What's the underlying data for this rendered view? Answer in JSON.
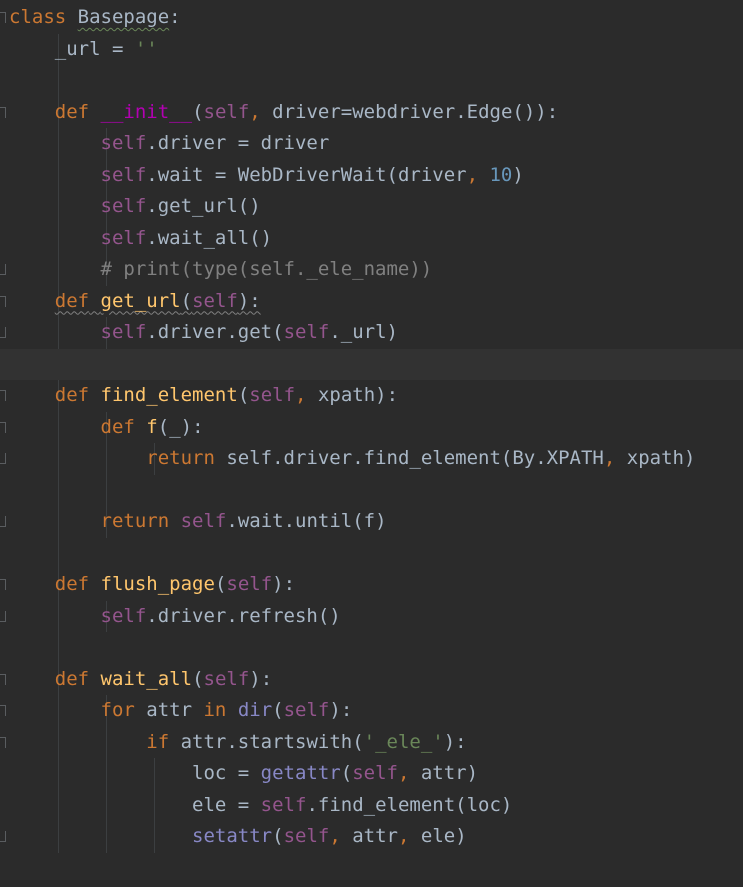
{
  "lines": [
    {
      "tokens": [
        [
          "kw",
          "class"
        ],
        [
          "plain",
          " "
        ],
        [
          "cls-sq",
          "Basepage"
        ],
        [
          "plain",
          ":"
        ]
      ]
    },
    {
      "tokens": [
        [
          "plain",
          "    _url = "
        ],
        [
          "str",
          "''"
        ]
      ]
    },
    {
      "tokens": []
    },
    {
      "tokens": [
        [
          "plain",
          "    "
        ],
        [
          "kw",
          "def"
        ],
        [
          "plain",
          " "
        ],
        [
          "dunder",
          "__init__"
        ],
        [
          "plain",
          "("
        ],
        [
          "self",
          "self"
        ],
        [
          "kw",
          ","
        ],
        [
          "plain",
          " driver=webdriver.Edge()):"
        ]
      ]
    },
    {
      "tokens": [
        [
          "plain",
          "        "
        ],
        [
          "self",
          "self"
        ],
        [
          "plain",
          ".driver = driver"
        ]
      ]
    },
    {
      "tokens": [
        [
          "plain",
          "        "
        ],
        [
          "self",
          "self"
        ],
        [
          "plain",
          ".wait = WebDriverWait(driver"
        ],
        [
          "kw",
          ","
        ],
        [
          "plain",
          " "
        ],
        [
          "num",
          "10"
        ],
        [
          "plain",
          ")"
        ]
      ]
    },
    {
      "tokens": [
        [
          "plain",
          "        "
        ],
        [
          "self",
          "self"
        ],
        [
          "plain",
          ".get_url()"
        ]
      ]
    },
    {
      "tokens": [
        [
          "plain",
          "        "
        ],
        [
          "self",
          "self"
        ],
        [
          "plain",
          ".wait_all()"
        ]
      ]
    },
    {
      "tokens": [
        [
          "cmt",
          "        # print(type(self._ele_name))"
        ]
      ]
    },
    {
      "tokens": [
        [
          "plain",
          "    "
        ],
        [
          "kw-sq",
          "def"
        ],
        [
          "plain-sq",
          " "
        ],
        [
          "fn-sq",
          "get_url"
        ],
        [
          "plain-sq",
          "("
        ],
        [
          "self-sq",
          "self"
        ],
        [
          "plain-sq",
          "):"
        ]
      ]
    },
    {
      "tokens": [
        [
          "plain",
          "        "
        ],
        [
          "self",
          "self"
        ],
        [
          "plain",
          ".driver.get("
        ],
        [
          "self",
          "self"
        ],
        [
          "plain",
          "._url)"
        ]
      ]
    },
    {
      "tokens": []
    },
    {
      "tokens": [
        [
          "plain",
          "    "
        ],
        [
          "kw",
          "def"
        ],
        [
          "plain",
          " "
        ],
        [
          "fn",
          "find_element"
        ],
        [
          "plain",
          "("
        ],
        [
          "self",
          "self"
        ],
        [
          "kw",
          ","
        ],
        [
          "plain",
          " xpath):"
        ]
      ]
    },
    {
      "tokens": [
        [
          "plain",
          "        "
        ],
        [
          "kw",
          "def"
        ],
        [
          "plain",
          " "
        ],
        [
          "fn",
          "f"
        ],
        [
          "plain",
          "(_):"
        ]
      ]
    },
    {
      "tokens": [
        [
          "plain",
          "            "
        ],
        [
          "kw",
          "return"
        ],
        [
          "plain",
          " self.driver.find_element(By.XPATH"
        ],
        [
          "kw",
          ","
        ],
        [
          "plain",
          " xpath)"
        ]
      ]
    },
    {
      "tokens": []
    },
    {
      "tokens": [
        [
          "plain",
          "        "
        ],
        [
          "kw",
          "return"
        ],
        [
          "plain",
          " "
        ],
        [
          "self",
          "self"
        ],
        [
          "plain",
          ".wait.until(f)"
        ]
      ]
    },
    {
      "tokens": []
    },
    {
      "tokens": [
        [
          "plain",
          "    "
        ],
        [
          "kw",
          "def"
        ],
        [
          "plain",
          " "
        ],
        [
          "fn",
          "flush_page"
        ],
        [
          "plain",
          "("
        ],
        [
          "self",
          "self"
        ],
        [
          "plain",
          "):"
        ]
      ]
    },
    {
      "tokens": [
        [
          "plain",
          "        "
        ],
        [
          "self",
          "self"
        ],
        [
          "plain",
          ".driver.refresh()"
        ]
      ]
    },
    {
      "tokens": []
    },
    {
      "tokens": [
        [
          "plain",
          "    "
        ],
        [
          "kw",
          "def"
        ],
        [
          "plain",
          " "
        ],
        [
          "fn",
          "wait_all"
        ],
        [
          "plain",
          "("
        ],
        [
          "self",
          "self"
        ],
        [
          "plain",
          "):"
        ]
      ]
    },
    {
      "tokens": [
        [
          "plain",
          "        "
        ],
        [
          "kw",
          "for"
        ],
        [
          "plain",
          " attr "
        ],
        [
          "kw",
          "in"
        ],
        [
          "plain",
          " "
        ],
        [
          "builtin",
          "dir"
        ],
        [
          "plain",
          "("
        ],
        [
          "self",
          "self"
        ],
        [
          "plain",
          "):"
        ]
      ]
    },
    {
      "tokens": [
        [
          "plain",
          "            "
        ],
        [
          "kw",
          "if"
        ],
        [
          "plain",
          " attr.startswith("
        ],
        [
          "str",
          "'_ele_'"
        ],
        [
          "plain",
          "):"
        ]
      ]
    },
    {
      "tokens": [
        [
          "plain",
          "                loc = "
        ],
        [
          "builtin",
          "getattr"
        ],
        [
          "plain",
          "("
        ],
        [
          "self",
          "self"
        ],
        [
          "kw",
          ","
        ],
        [
          "plain",
          " attr)"
        ]
      ]
    },
    {
      "tokens": [
        [
          "plain",
          "                ele = "
        ],
        [
          "self",
          "self"
        ],
        [
          "plain",
          ".find_element(loc)"
        ]
      ]
    },
    {
      "tokens": [
        [
          "plain",
          "                "
        ],
        [
          "builtin",
          "setattr"
        ],
        [
          "plain",
          "("
        ],
        [
          "self",
          "self"
        ],
        [
          "kw",
          ","
        ],
        [
          "plain",
          " attr"
        ],
        [
          "kw",
          ","
        ],
        [
          "plain",
          " ele)"
        ]
      ]
    }
  ],
  "gutter": {
    "fold_open_lines": [
      0,
      3,
      9,
      12,
      13,
      18,
      21,
      22,
      23
    ],
    "fold_close_lines": [
      8,
      10,
      14,
      16,
      19,
      26
    ]
  },
  "current_line": 11
}
